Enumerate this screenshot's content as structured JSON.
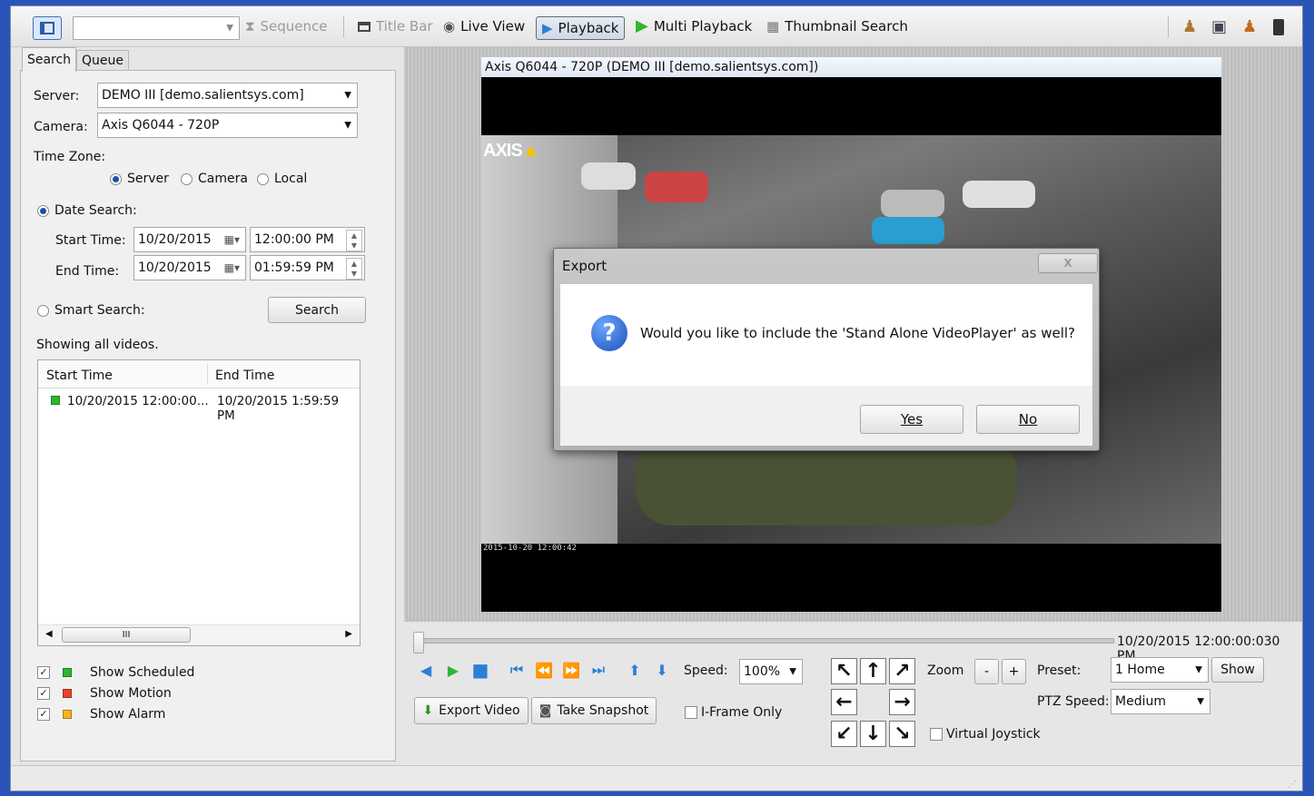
{
  "toolbar": {
    "sequence": "Sequence",
    "title_bar": "Title Bar",
    "live_view": "Live View",
    "playback": "Playback",
    "multi_playback": "Multi Playback",
    "thumbnail_search": "Thumbnail Search"
  },
  "tabs": {
    "search": "Search",
    "queue": "Queue"
  },
  "search_panel": {
    "server_label": "Server:",
    "server_value": "DEMO III [demo.salientsys.com]",
    "camera_label": "Camera:",
    "camera_value": "Axis Q6044 - 720P",
    "timezone_label": "Time Zone:",
    "tz_server": "Server",
    "tz_camera": "Camera",
    "tz_local": "Local",
    "date_search_label": "Date Search:",
    "start_time_label": "Start Time:",
    "start_date": "10/20/2015",
    "start_time": "12:00:00 PM",
    "end_time_label": "End Time:",
    "end_date": "10/20/2015",
    "end_time": "01:59:59 PM",
    "smart_search_label": "Smart Search:",
    "search_button": "Search",
    "showing": "Showing all videos.",
    "col_start": "Start Time",
    "col_end": "End Time",
    "rows": [
      {
        "start": "10/20/2015 12:00:00...",
        "end": "10/20/2015 1:59:59 PM"
      }
    ],
    "scroll_thumb": "III",
    "show_scheduled": "Show Scheduled",
    "show_motion": "Show Motion",
    "show_alarm": "Show Alarm"
  },
  "video": {
    "title": "Axis Q6044 - 720P (DEMO III [demo.salientsys.com])",
    "logo": "AXIS",
    "timestamp": "2015-10-20 12:00:42"
  },
  "dialog": {
    "title": "Export",
    "message": "Would you like to include the 'Stand Alone VideoPlayer' as well?",
    "yes": "Yes",
    "no": "No",
    "close": "X"
  },
  "controls": {
    "timestamp": "10/20/2015 12:00:00:030 PM",
    "speed_label": "Speed:",
    "speed_value": "100%",
    "export_video": "Export Video",
    "take_snapshot": "Take Snapshot",
    "iframe_only": "I-Frame Only",
    "zoom_label": "Zoom",
    "zoom_minus": "-",
    "zoom_plus": "+",
    "preset_label": "Preset:",
    "preset_value": "1 Home",
    "show_button": "Show",
    "ptz_speed_label": "PTZ Speed:",
    "ptz_speed_value": "Medium",
    "virtual_joystick": "Virtual Joystick"
  },
  "colors": {
    "scheduled": "#2fb52f",
    "motion": "#e8432a",
    "alarm": "#f2b51a",
    "accent": "#2b7fd6"
  }
}
